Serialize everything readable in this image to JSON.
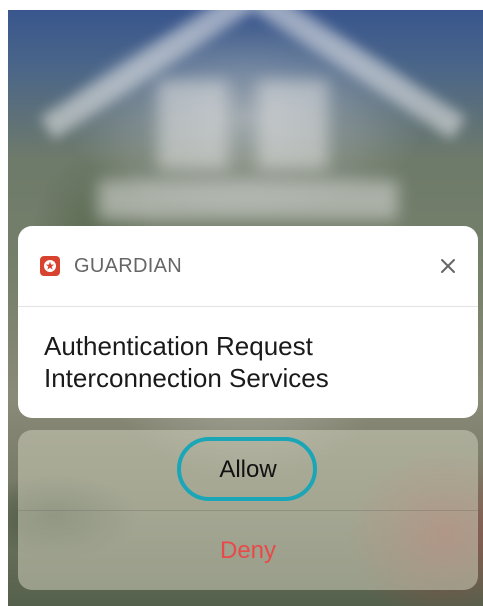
{
  "notification": {
    "app_name": "GUARDIAN",
    "app_icon": "shield-star-icon",
    "close_icon": "close-icon",
    "title": "Authentication Request",
    "subtitle": "Interconnection Services"
  },
  "actions": {
    "allow_label": "Allow",
    "deny_label": "Deny"
  },
  "colors": {
    "app_icon_bg": "#d8432f",
    "deny_text": "#e84a4a",
    "highlight_ring": "#1aa6b7"
  }
}
